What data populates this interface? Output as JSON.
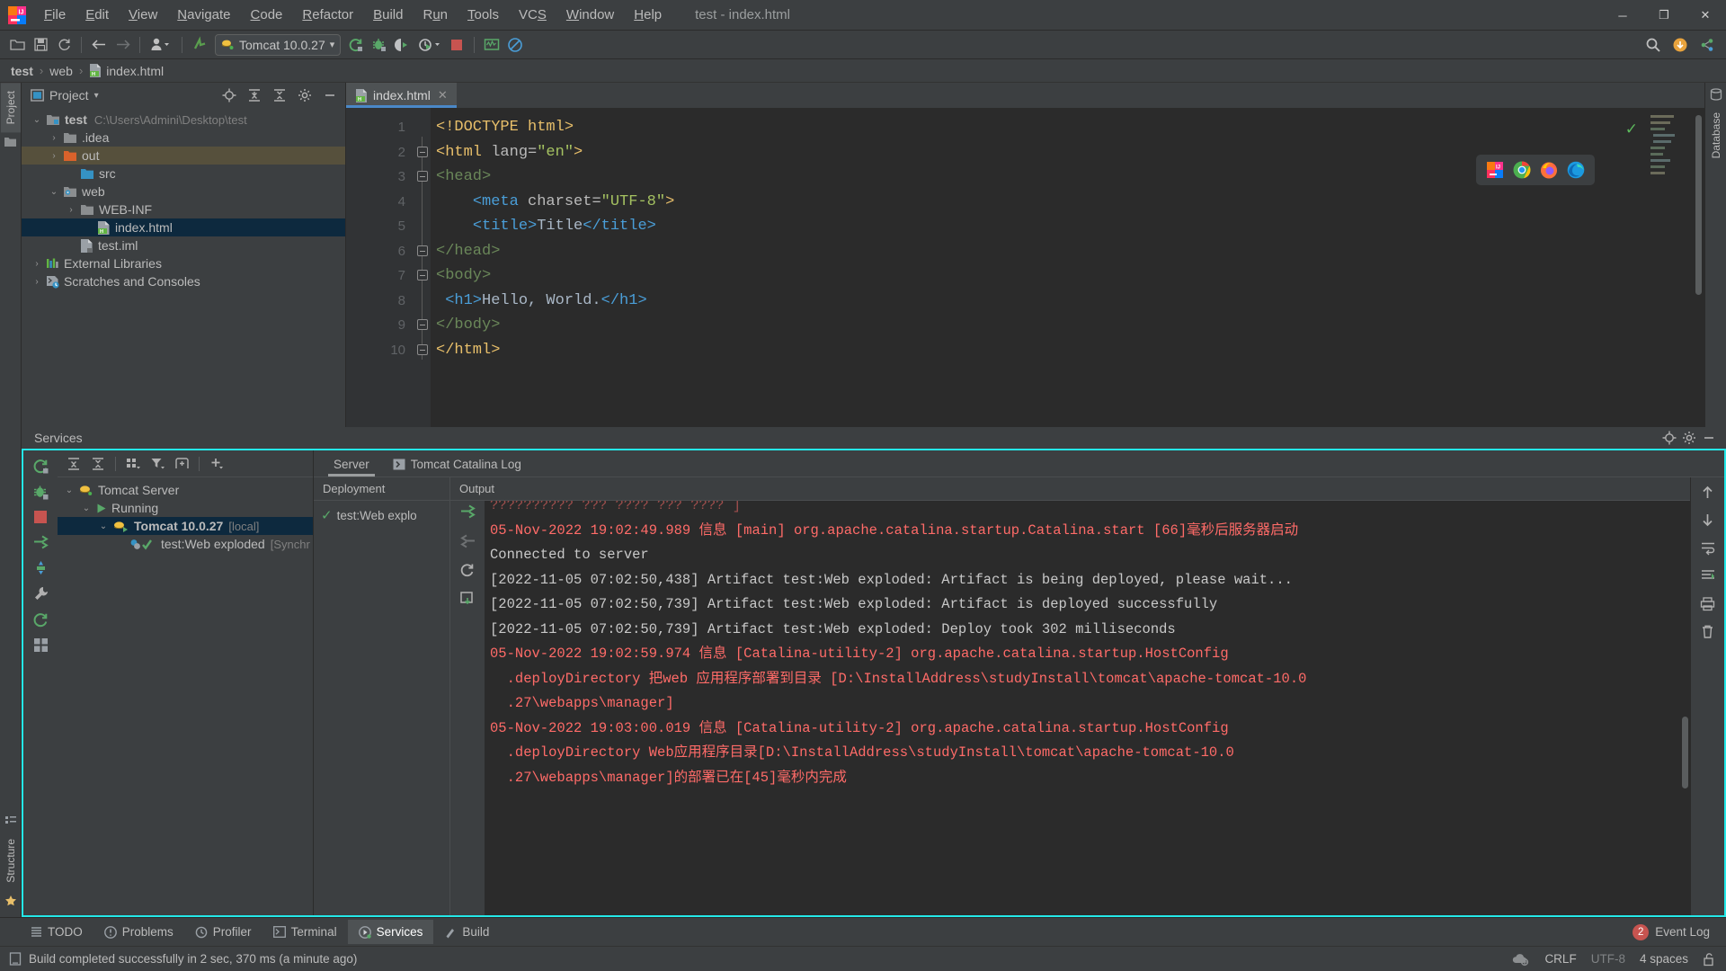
{
  "window": {
    "title": "test - index.html",
    "app_icon": "intellij-idea-icon",
    "controls": {
      "minimize": "─",
      "maximize": "❐",
      "close": "✕"
    }
  },
  "menubar": {
    "items": [
      {
        "label": "File",
        "mnemonic": "F"
      },
      {
        "label": "Edit",
        "mnemonic": "E"
      },
      {
        "label": "View",
        "mnemonic": "V"
      },
      {
        "label": "Navigate",
        "mnemonic": "N"
      },
      {
        "label": "Code",
        "mnemonic": "C"
      },
      {
        "label": "Refactor",
        "mnemonic": "R"
      },
      {
        "label": "Build",
        "mnemonic": "B"
      },
      {
        "label": "Run",
        "mnemonic": "R"
      },
      {
        "label": "Tools",
        "mnemonic": "T"
      },
      {
        "label": "VCS",
        "mnemonic": "S"
      },
      {
        "label": "Window",
        "mnemonic": "W"
      },
      {
        "label": "Help",
        "mnemonic": "H"
      }
    ]
  },
  "toolbar": {
    "open_icon": "open-folder-icon",
    "save_icon": "save-icon",
    "sync_icon": "sync-icon",
    "back_icon": "arrow-left-icon",
    "forward_icon": "arrow-right-icon",
    "profile_icon": "user-profile-icon",
    "update_icon": "update-project-icon",
    "run_config": {
      "label": "Tomcat 10.0.27",
      "icon": "tomcat-icon",
      "dropdown": "▾"
    },
    "rerun_icon": "rerun-icon",
    "debug_icon": "debug-icon",
    "run_with_coverage_icon": "coverage-icon",
    "profile_run_icon": "profile-run-icon",
    "stop_icon": "stop-icon",
    "monitor_icon": "monitor-icon",
    "disabled_icon": "no-entry-icon",
    "search_icon": "search-icon",
    "plugin_icon": "plugin-update-icon",
    "share_icon": "share-icon"
  },
  "breadcrumb": {
    "items": [
      {
        "label": "test",
        "bold": true,
        "icon": null
      },
      {
        "label": "web",
        "bold": false,
        "icon": null
      },
      {
        "label": "index.html",
        "bold": false,
        "icon": "html-file-icon"
      }
    ],
    "separator": "›"
  },
  "left_rail": {
    "tabs": [
      {
        "label": "Project",
        "active": true
      }
    ],
    "icons": [
      "folder-icon"
    ],
    "bottom_tabs": [
      {
        "label": "Structure"
      },
      {
        "label": "Favorites"
      }
    ]
  },
  "project_panel": {
    "title": "Project",
    "dropdown_icon": "chevron-down-icon",
    "header_buttons": [
      "locate-icon",
      "expand-all-icon",
      "collapse-all-icon",
      "gear-icon",
      "hide-icon"
    ],
    "tree": [
      {
        "indent": 0,
        "arrow": "⌄",
        "icon": "module-folder-icon",
        "label": "test",
        "bold": true,
        "path": "C:\\Users\\Admini\\Desktop\\test",
        "state": "normal"
      },
      {
        "indent": 1,
        "arrow": "›",
        "icon": "folder-icon",
        "label": ".idea",
        "bold": false,
        "path": "",
        "state": "normal"
      },
      {
        "indent": 1,
        "arrow": "›",
        "icon": "excluded-folder-icon",
        "label": "out",
        "bold": false,
        "path": "",
        "state": "highlight"
      },
      {
        "indent": 2,
        "arrow": "",
        "icon": "source-folder-icon",
        "label": "src",
        "bold": false,
        "path": "",
        "state": "normal"
      },
      {
        "indent": 1,
        "arrow": "⌄",
        "icon": "web-folder-icon",
        "label": "web",
        "bold": false,
        "path": "",
        "state": "normal"
      },
      {
        "indent": 2,
        "arrow": "›",
        "icon": "folder-icon",
        "label": "WEB-INF",
        "bold": false,
        "path": "",
        "state": "normal"
      },
      {
        "indent": 3,
        "arrow": "",
        "icon": "html-file-icon",
        "label": "index.html",
        "bold": false,
        "path": "",
        "state": "selected"
      },
      {
        "indent": 2,
        "arrow": "",
        "icon": "iml-file-icon",
        "label": "test.iml",
        "bold": false,
        "path": "",
        "state": "normal"
      },
      {
        "indent": 0,
        "arrow": "›",
        "icon": "libraries-icon",
        "label": "External Libraries",
        "bold": false,
        "path": "",
        "state": "normal"
      },
      {
        "indent": 0,
        "arrow": "›",
        "icon": "scratches-icon",
        "label": "Scratches and Consoles",
        "bold": false,
        "path": "",
        "state": "normal"
      }
    ]
  },
  "editor": {
    "tabs": [
      {
        "label": "index.html",
        "icon": "html-file-icon",
        "close": "✕",
        "active": true
      }
    ],
    "line_numbers": [
      "1",
      "2",
      "3",
      "4",
      "5",
      "6",
      "7",
      "8",
      "9",
      "10"
    ],
    "lines": [
      {
        "n": 1,
        "fold": false,
        "fold_end": false,
        "tokens": [
          {
            "t": "<!DOCTYPE html>",
            "c": "tg"
          }
        ]
      },
      {
        "n": 2,
        "fold": true,
        "fold_end": false,
        "tokens": [
          {
            "t": "<html ",
            "c": "tg"
          },
          {
            "t": "lang=",
            "c": "an"
          },
          {
            "t": "\"en\"",
            "c": "va"
          },
          {
            "t": ">",
            "c": "tg"
          }
        ]
      },
      {
        "n": 3,
        "fold": true,
        "fold_end": false,
        "tokens": [
          {
            "t": "<head>",
            "c": "tg2"
          }
        ]
      },
      {
        "n": 4,
        "fold": false,
        "fold_end": false,
        "tokens": [
          {
            "t": "    ",
            "c": "pl"
          },
          {
            "t": "<meta ",
            "c": "br"
          },
          {
            "t": "charset=",
            "c": "an"
          },
          {
            "t": "\"UTF-8\"",
            "c": "va"
          },
          {
            "t": ">",
            "c": "tg"
          }
        ]
      },
      {
        "n": 5,
        "fold": false,
        "fold_end": false,
        "tokens": [
          {
            "t": "    ",
            "c": "pl"
          },
          {
            "t": "<title>",
            "c": "br"
          },
          {
            "t": "Title",
            "c": "pl"
          },
          {
            "t": "</title>",
            "c": "br"
          }
        ]
      },
      {
        "n": 6,
        "fold": false,
        "fold_end": true,
        "tokens": [
          {
            "t": "</head>",
            "c": "tg2"
          }
        ]
      },
      {
        "n": 7,
        "fold": true,
        "fold_end": false,
        "tokens": [
          {
            "t": "<body>",
            "c": "tg2"
          }
        ]
      },
      {
        "n": 8,
        "fold": false,
        "fold_end": false,
        "tokens": [
          {
            "t": " ",
            "c": "pl"
          },
          {
            "t": "<h1>",
            "c": "br"
          },
          {
            "t": "Hello, World.",
            "c": "pl"
          },
          {
            "t": "</h1>",
            "c": "br"
          }
        ]
      },
      {
        "n": 9,
        "fold": false,
        "fold_end": true,
        "tokens": [
          {
            "t": "</body>",
            "c": "tg2"
          }
        ]
      },
      {
        "n": 10,
        "fold": false,
        "fold_end": true,
        "tokens": [
          {
            "t": "</html>",
            "c": "tg"
          }
        ]
      }
    ],
    "browser_bar": [
      "intellij-browser-icon",
      "chrome-icon",
      "firefox-icon",
      "edge-icon"
    ],
    "inspection_ok_icon": "checkmark-icon"
  },
  "right_rail": {
    "tabs": [
      {
        "label": "Database"
      }
    ]
  },
  "services": {
    "title": "Services",
    "header_icons": [
      "locate-icon",
      "gear-icon",
      "hide-icon"
    ],
    "side_toolbar": [
      "rerun-icon",
      "debug-icon",
      "stop-icon",
      "deploy-icon",
      "edit-config-icon",
      "wrench-icon",
      "restart-icon",
      "layout-icon"
    ],
    "tree_toolbar": [
      "expand-all-icon",
      "collapse-all-icon",
      "group-icon",
      "filter-icon",
      "add-tab-icon",
      "add-icon"
    ],
    "tree": [
      {
        "indent": 0,
        "arrow": "⌄",
        "icon": "tomcat-icon",
        "label": "Tomcat Server",
        "suffix": "",
        "bold": false,
        "state": "normal"
      },
      {
        "indent": 1,
        "arrow": "⌄",
        "icon": "play-icon",
        "label": "Running",
        "suffix": "",
        "bold": false,
        "state": "normal"
      },
      {
        "indent": 2,
        "arrow": "⌄",
        "icon": "tomcat-run-icon",
        "label": "Tomcat 10.0.27",
        "suffix": "[local]",
        "bold": true,
        "state": "selected"
      },
      {
        "indent": 3,
        "arrow": "",
        "icon": "artifact-check-icon",
        "label": "test:Web exploded",
        "suffix": "[Synchr",
        "bold": false,
        "state": "normal"
      }
    ],
    "tabs": [
      {
        "label": "Server",
        "icon": null,
        "active": true
      },
      {
        "label": "Tomcat Catalina Log",
        "icon": "log-icon",
        "active": false
      }
    ],
    "deployment": {
      "column_header": "Deployment",
      "item": {
        "label": "test:Web explo",
        "icon": "checkmark-green-icon"
      },
      "actions": [
        "deploy-icon",
        "undeploy-icon",
        "redeploy-icon",
        "update-icon"
      ]
    },
    "output": {
      "column_header": "Output",
      "lines": [
        {
          "text": "?????????? ??? ???? ??? ???? ]",
          "type": "err",
          "clipped": true
        },
        {
          "text": "05-Nov-2022 19:02:49.989 信息 [main] org.apache.catalina.startup.Catalina.start [66]毫秒后服务器启动",
          "type": "err"
        },
        {
          "text": "Connected to server",
          "type": "norm"
        },
        {
          "text": "[2022-11-05 07:02:50,438] Artifact test:Web exploded: Artifact is being deployed, please wait...",
          "type": "norm"
        },
        {
          "text": "[2022-11-05 07:02:50,739] Artifact test:Web exploded: Artifact is deployed successfully",
          "type": "norm"
        },
        {
          "text": "[2022-11-05 07:02:50,739] Artifact test:Web exploded: Deploy took 302 milliseconds",
          "type": "norm"
        },
        {
          "text": "05-Nov-2022 19:02:59.974 信息 [Catalina-utility-2] org.apache.catalina.startup.HostConfig",
          "type": "err"
        },
        {
          "text": "  .deployDirectory 把web 应用程序部署到目录 [D:\\InstallAddress\\studyInstall\\tomcat\\apache-tomcat-10.0",
          "type": "err"
        },
        {
          "text": "  .27\\webapps\\manager]",
          "type": "err"
        },
        {
          "text": "05-Nov-2022 19:03:00.019 信息 [Catalina-utility-2] org.apache.catalina.startup.HostConfig",
          "type": "err"
        },
        {
          "text": "  .deployDirectory Web应用程序目录[D:\\InstallAddress\\studyInstall\\tomcat\\apache-tomcat-10.0",
          "type": "err"
        },
        {
          "text": "  .27\\webapps\\manager]的部署已在[45]毫秒内完成",
          "type": "err"
        }
      ],
      "actions": [
        "scroll-up-icon",
        "scroll-down-icon",
        "soft-wrap-icon",
        "scroll-end-icon",
        "print-icon",
        "trash-icon"
      ]
    }
  },
  "tool_window_bar": {
    "tabs": [
      {
        "label": "TODO",
        "icon": "todo-icon",
        "active": false
      },
      {
        "label": "Problems",
        "icon": "problems-icon",
        "active": false
      },
      {
        "label": "Profiler",
        "icon": "profiler-icon",
        "active": false
      },
      {
        "label": "Terminal",
        "icon": "terminal-icon",
        "active": false
      },
      {
        "label": "Services",
        "icon": "services-icon",
        "active": true
      },
      {
        "label": "Build",
        "icon": "build-icon",
        "active": false
      }
    ],
    "event_log": {
      "label": "Event Log",
      "count": "2"
    }
  },
  "status_bar": {
    "icon": "memory-icon",
    "message": "Build completed successfully in 2 sec, 370 ms (a minute ago)",
    "right": {
      "inspection_icon": "inspection-icon",
      "line_separator": "CRLF",
      "encoding": "UTF-8",
      "indent": "4 spaces",
      "lock_icon": "unlocked-icon"
    }
  },
  "colors": {
    "accent_cyan": "#24e8e8",
    "panel_bg": "#3c3f41",
    "editor_bg": "#2b2b2b",
    "selection": "#0d293e",
    "error_text": "#ff6b68",
    "tab_underline": "#4a88c7",
    "badge": "#c75450"
  }
}
